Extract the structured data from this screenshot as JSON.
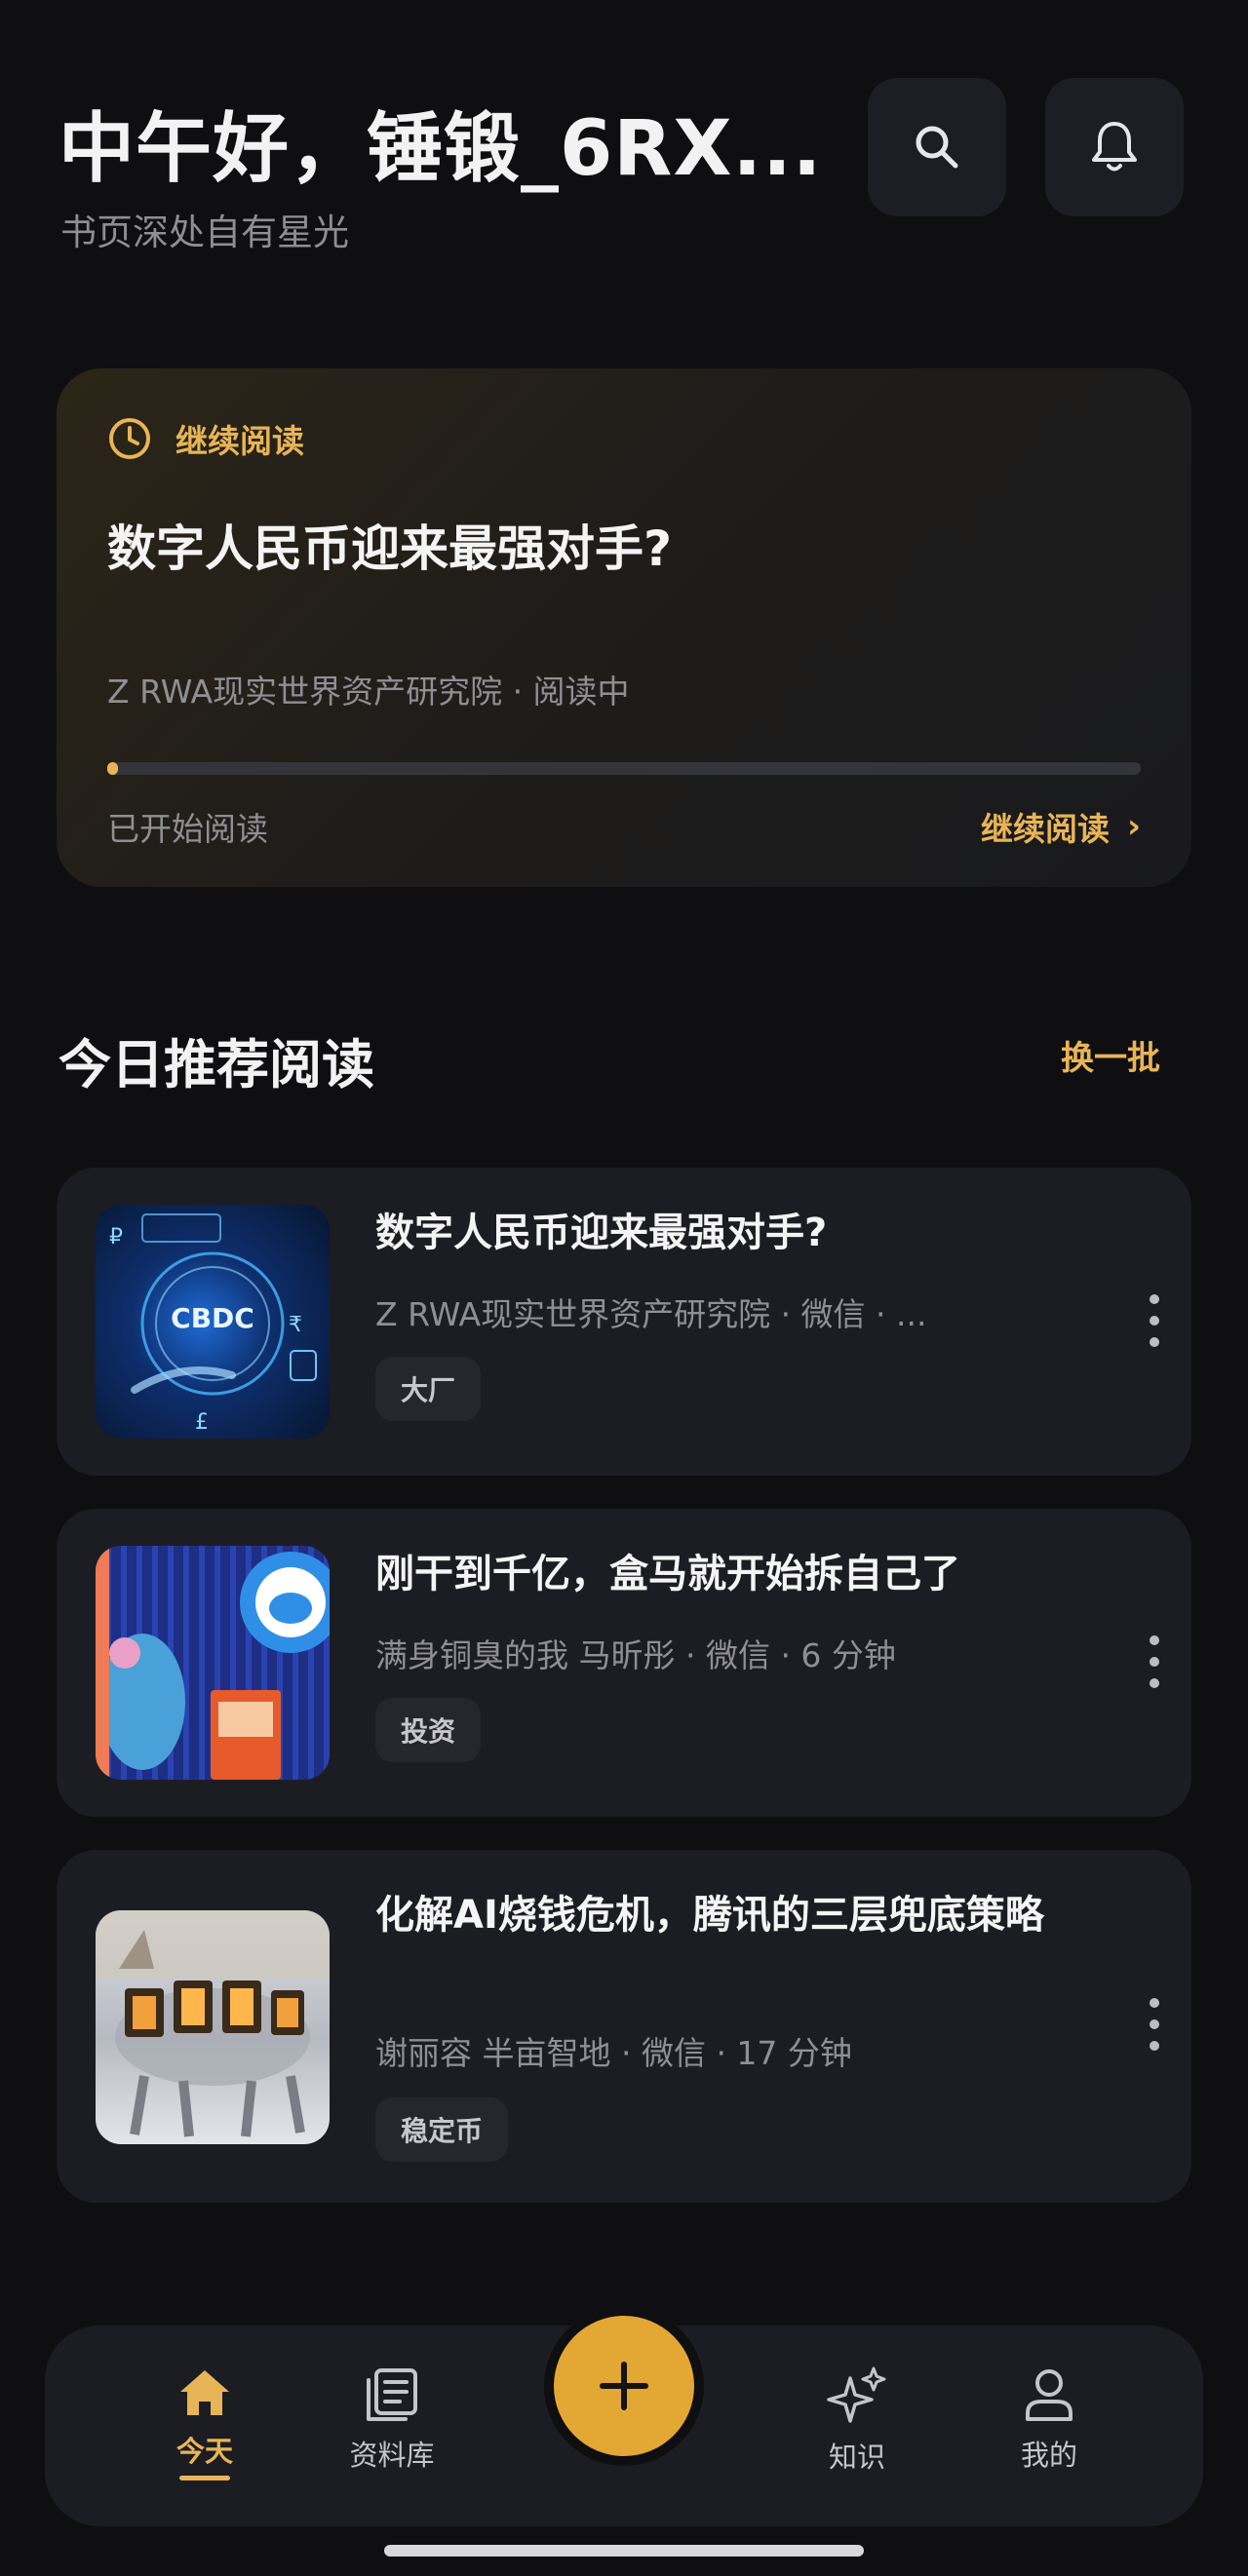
{
  "header": {
    "greeting": "中午好，锤锻_6RX...",
    "subtitle": "书页深处自有星光",
    "search_icon": "search-icon",
    "bell_icon": "bell-icon"
  },
  "continue_reading": {
    "label": "继续阅读",
    "title": "数字人民币迎来最强对手?",
    "meta": "Z RWA现实世界资产研究院 · 阅读中",
    "progress": 0.01,
    "status": "已开始阅读",
    "action_label": "继续阅读",
    "action_chevron": "›"
  },
  "recommend": {
    "title": "今日推荐阅读",
    "refresh_label": "换一批",
    "items": [
      {
        "title": "数字人民币迎来最强对手?",
        "meta": "Z RWA现实世界资产研究院 · 微信 · ...",
        "tag": "大厂",
        "thumb_text": "CBDC"
      },
      {
        "title": "刚干到千亿，盒马就开始拆自己了",
        "meta": "满身铜臭的我 马昕彤 · 微信 · 6 分钟",
        "tag": "投资"
      },
      {
        "title": "化解AI烧钱危机，腾讯的三层兜底策略",
        "meta": "谢丽容 半亩智地 · 微信 · 17 分钟",
        "tag": "稳定币"
      }
    ]
  },
  "bottom_nav": {
    "items": [
      {
        "label": "今天",
        "icon": "home-icon",
        "active": true
      },
      {
        "label": "资料库",
        "icon": "library-icon",
        "active": false
      },
      {
        "label": "知识",
        "icon": "sparkle-icon",
        "active": false
      },
      {
        "label": "我的",
        "icon": "person-icon",
        "active": false
      }
    ],
    "fab_icon": "plus-icon"
  },
  "colors": {
    "accent": "#e8b556",
    "background": "#0f0f11",
    "card": "#1c1d22"
  }
}
